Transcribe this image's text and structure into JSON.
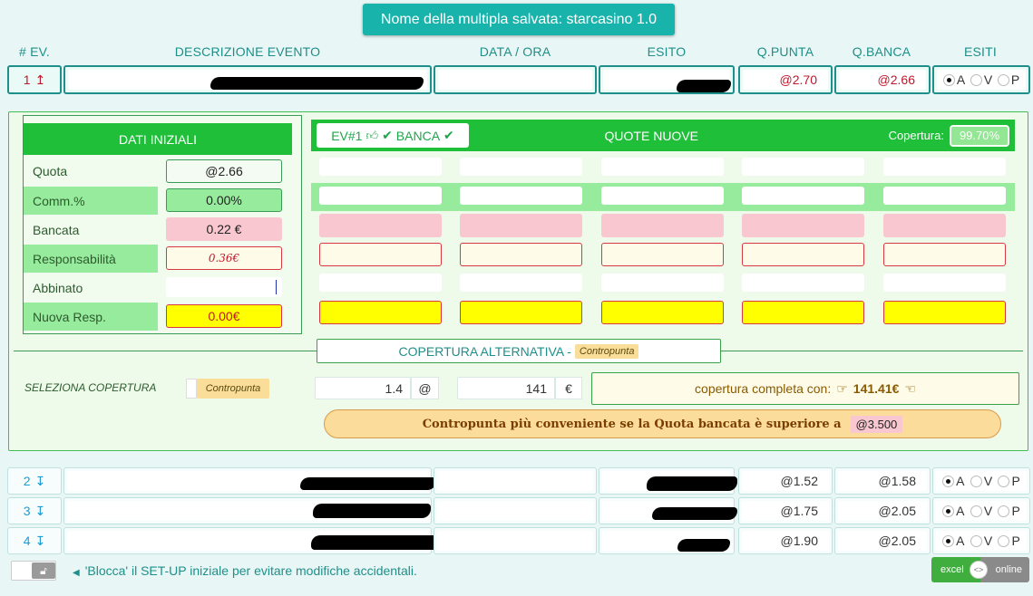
{
  "title": "Nome della multipla salvata: starcasino 1.0",
  "headers": {
    "ev": "# EV.",
    "descrizione": "DESCRIZIONE EVENTO",
    "data_ora": "DATA / ORA",
    "esito": "ESITO",
    "q_punta": "Q.PUNTA",
    "q_banca": "Q.BANCA",
    "esiti": "ESITI"
  },
  "radio_labels": [
    "A",
    "V",
    "P"
  ],
  "events": [
    {
      "num": "1",
      "arrow": "↥",
      "q_punta": "@2.70",
      "q_banca": "@2.66",
      "selected": "A"
    },
    {
      "num": "2",
      "arrow": "↧",
      "q_punta": "@1.52",
      "q_banca": "@1.58",
      "selected": "A"
    },
    {
      "num": "3",
      "arrow": "↧",
      "q_punta": "@1.75",
      "q_banca": "@2.05",
      "selected": "A"
    },
    {
      "num": "4",
      "arrow": "↧",
      "q_punta": "@1.90",
      "q_banca": "@2.05",
      "selected": "A"
    }
  ],
  "dati_iniziali": {
    "title": "DATI INIZIALI",
    "rows": [
      {
        "label": "Quota",
        "value": "@2.66"
      },
      {
        "label": "Comm.%",
        "value": "0.00%"
      },
      {
        "label": "Bancata",
        "value": "0.22 €"
      },
      {
        "label": "Responsabilità",
        "value": "0.36€"
      },
      {
        "label": "Abbinato",
        "value": ""
      },
      {
        "label": "Nuova Resp.",
        "value": "0.00€"
      }
    ]
  },
  "quote_nuove": {
    "ev_label": "EV#1",
    "banca_label": "BANCA",
    "title": "QUOTE NUOVE",
    "copertura_label": "Copertura:",
    "copertura_value": "99.70%"
  },
  "alternativa": {
    "title": "COPERTURA ALTERNATIVA -",
    "tag": "Contropunta",
    "seleziona_label": "SELEZIONA COPERTURA",
    "seleziona_option": "Contropunta",
    "quota_value": "1.4",
    "quota_unit": "@",
    "importo_value": "141",
    "importo_unit": "€",
    "completa_label": "copertura completa con:",
    "completa_value": "141.41€",
    "conveniente_text": "Contropunta più conveniente se la Quota bancata è superiore a",
    "conveniente_value": "@3.500"
  },
  "footer": {
    "hint": "'Blocca' il SET-UP iniziale per evitare modifiche accidentali.",
    "excel": "excel",
    "online": "online",
    "code": "<>"
  },
  "colors": {
    "accent": "#18b4ac",
    "green": "#1fbf3a",
    "red": "#c0172b",
    "yellow": "#ffff00"
  }
}
